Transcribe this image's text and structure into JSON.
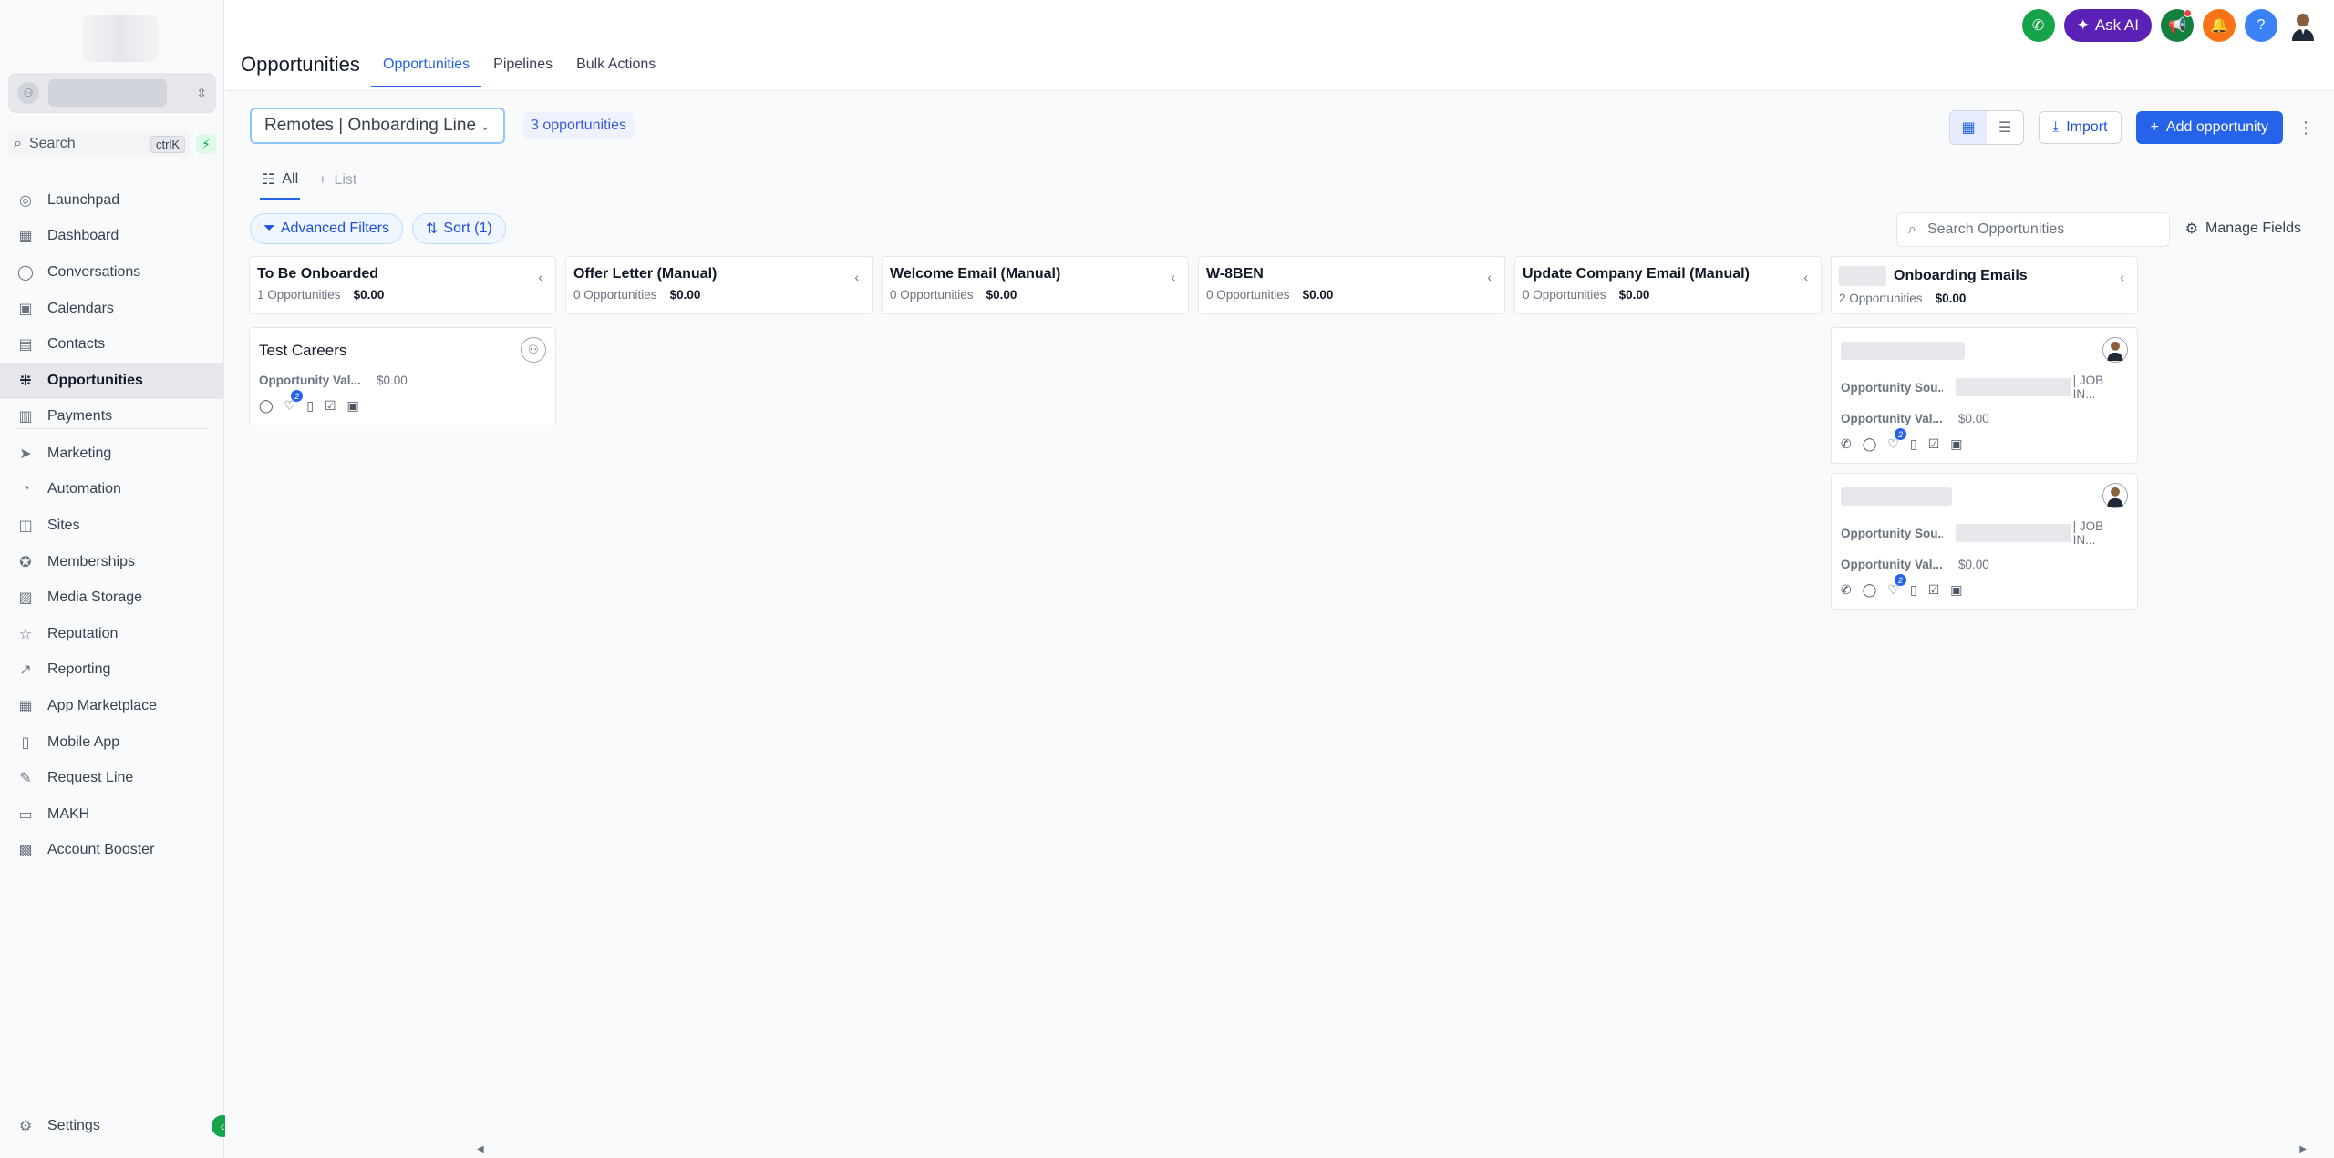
{
  "sidebar": {
    "search": {
      "label": "Search",
      "shortcut": "ctrlK"
    },
    "items": [
      {
        "id": "launchpad",
        "label": "Launchpad",
        "icon": "◎"
      },
      {
        "id": "dashboard",
        "label": "Dashboard",
        "icon": "▦"
      },
      {
        "id": "conversations",
        "label": "Conversations",
        "icon": "◯"
      },
      {
        "id": "calendars",
        "label": "Calendars",
        "icon": "▣"
      },
      {
        "id": "contacts",
        "label": "Contacts",
        "icon": "▤"
      },
      {
        "id": "opportunities",
        "label": "Opportunities",
        "icon": "⁜",
        "active": true
      },
      {
        "id": "payments",
        "label": "Payments",
        "icon": "▥"
      }
    ],
    "items2": [
      {
        "id": "marketing",
        "label": "Marketing",
        "icon": "➤"
      },
      {
        "id": "automation",
        "label": "Automation",
        "icon": "◔"
      },
      {
        "id": "sites",
        "label": "Sites",
        "icon": "◫"
      },
      {
        "id": "memberships",
        "label": "Memberships",
        "icon": "✪"
      },
      {
        "id": "media-storage",
        "label": "Media Storage",
        "icon": "▨"
      },
      {
        "id": "reputation",
        "label": "Reputation",
        "icon": "☆"
      },
      {
        "id": "reporting",
        "label": "Reporting",
        "icon": "↗"
      },
      {
        "id": "app-marketplace",
        "label": "App Marketplace",
        "icon": "▦"
      },
      {
        "id": "mobile-app",
        "label": "Mobile App",
        "icon": "▯"
      },
      {
        "id": "request-line",
        "label": "Request Line",
        "icon": "✎"
      },
      {
        "id": "makh",
        "label": "MAKH",
        "icon": "▭"
      },
      {
        "id": "account-booster",
        "label": "Account Booster",
        "icon": "▩"
      }
    ],
    "settings_label": "Settings"
  },
  "header": {
    "title": "Opportunities",
    "tabs": [
      {
        "label": "Opportunities",
        "active": true
      },
      {
        "label": "Pipelines",
        "active": false
      },
      {
        "label": "Bulk Actions",
        "active": false
      }
    ],
    "ask_ai_label": "Ask AI"
  },
  "toolbar": {
    "pipeline": "Remotes | Onboarding Line",
    "count_label": "3 opportunities",
    "import_label": "Import",
    "add_label": "Add opportunity"
  },
  "subtabs": {
    "all_label": "All",
    "add_label": "List"
  },
  "filters": {
    "advanced_label": "Advanced Filters",
    "sort_label": "Sort (1)",
    "search_placeholder": "Search Opportunities",
    "manage_fields_label": "Manage Fields"
  },
  "columns": [
    {
      "title": "To Be Onboarded",
      "count": "1 Opportunities",
      "value": "$0.00"
    },
    {
      "title": "Offer Letter (Manual)",
      "count": "0 Opportunities",
      "value": "$0.00"
    },
    {
      "title": "Welcome Email (Manual)",
      "count": "0 Opportunities",
      "value": "$0.00"
    },
    {
      "title": "W-8BEN",
      "count": "0 Opportunities",
      "value": "$0.00"
    },
    {
      "title": "Update Company Email (Manual)",
      "count": "0 Opportunities",
      "value": "$0.00"
    },
    {
      "title": "Onboarding Emails",
      "count": "2 Opportunities",
      "value": "$0.00"
    }
  ],
  "cards": {
    "test_careers": {
      "title": "Test Careers",
      "value_label": "Opportunity Val...",
      "value": "$0.00",
      "badge": "2"
    },
    "onboarding_card_1": {
      "source_label": "Opportunity Sou...",
      "source_value": "| JOB IN...",
      "value_label": "Opportunity Val...",
      "value": "$0.00",
      "badge": "2"
    },
    "onboarding_card_2": {
      "source_label": "Opportunity Sou...",
      "source_value": "| JOB IN...",
      "value_label": "Opportunity Val...",
      "value": "$0.00",
      "badge": "2"
    }
  },
  "colors": {
    "accent": "#2563eb",
    "phone_button": "#16a34a",
    "ask_ai": "#5b21b6",
    "megaphone_button": "#15803d",
    "bell_button": "#f97316",
    "help_button": "#3b82f6"
  }
}
